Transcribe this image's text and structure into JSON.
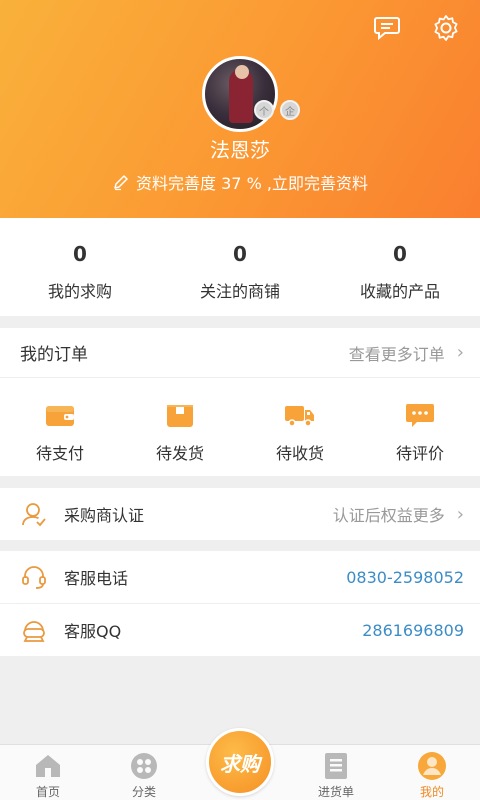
{
  "header": {
    "username": "法恩莎",
    "profile_prompt": "资料完善度 37 % ,立即完善资料",
    "badge_personal": "个",
    "badge_company": "企",
    "icons": [
      "message-icon",
      "settings-icon"
    ]
  },
  "stats": [
    {
      "value": "0",
      "label": "我的求购"
    },
    {
      "value": "0",
      "label": "关注的商铺"
    },
    {
      "value": "0",
      "label": "收藏的产品"
    }
  ],
  "orders": {
    "title": "我的订单",
    "more": "查看更多订单",
    "items": [
      {
        "label": "待支付",
        "icon": "wallet-icon"
      },
      {
        "label": "待发货",
        "icon": "box-icon"
      },
      {
        "label": "待收货",
        "icon": "truck-icon"
      },
      {
        "label": "待评价",
        "icon": "comment-icon"
      }
    ]
  },
  "certification": {
    "label": "采购商认证",
    "hint": "认证后权益更多"
  },
  "service": {
    "phone_label": "客服电话",
    "phone_value": "0830-2598052",
    "qq_label": "客服QQ",
    "qq_value": "2861696809"
  },
  "tabbar": {
    "tabs": [
      {
        "label": "首页",
        "icon": "home-icon"
      },
      {
        "label": "分类",
        "icon": "category-icon"
      },
      {
        "label": "",
        "icon": ""
      },
      {
        "label": "进货单",
        "icon": "purchase-list-icon"
      },
      {
        "label": "我的",
        "icon": "profile-icon"
      }
    ],
    "center_button": "求购"
  },
  "colors": {
    "header_start": "#f9b13b",
    "header_end": "#fa7f2f",
    "accent": "#f08a24",
    "link_blue": "#3c8cc6"
  }
}
